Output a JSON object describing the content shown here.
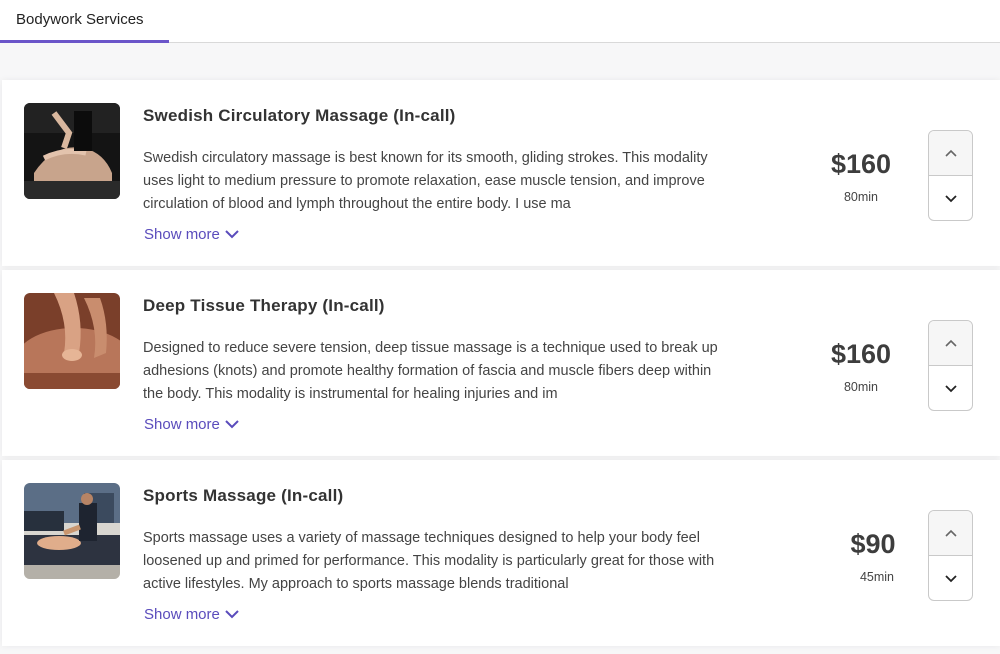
{
  "tabs": [
    {
      "label": "Bodywork Services",
      "active": true
    }
  ],
  "services": [
    {
      "title": "Swedish Circulatory Massage (In-call)",
      "description_lines": [
        "Swedish circulatory massage is best known for its smooth, gliding strokes. This modality",
        "uses light to medium pressure to promote relaxation, ease muscle tension, and improve",
        "circulation of blood and lymph throughout the entire body. I use ma"
      ],
      "show_more": "Show more",
      "price": "$160",
      "duration": "80min",
      "image": "swedish-massage-photo"
    },
    {
      "title": "Deep Tissue Therapy (In-call)",
      "description_lines": [
        "Designed to reduce severe tension, deep tissue massage is a technique used to break up",
        "adhesions (knots) and promote healthy formation of fascia and muscle fibers deep within",
        "the body. This modality is instrumental for healing injuries and im"
      ],
      "show_more": "Show more",
      "price": "$160",
      "duration": "80min",
      "image": "deep-tissue-photo"
    },
    {
      "title": "Sports Massage (In-call)",
      "description_lines": [
        "Sports massage uses a variety of massage techniques designed to help your body feel",
        "loosened up and primed for performance. This modality is particularly great for those with",
        "active lifestyles. My approach to sports massage blends traditional"
      ],
      "show_more": "Show more",
      "price": "$90",
      "duration": "45min",
      "image": "sports-massage-photo"
    }
  ],
  "icons": {
    "expand": "chevron-down-icon",
    "increment": "chevron-up-icon",
    "decrement": "chevron-down-icon"
  },
  "colors": {
    "accent": "#6b55c9",
    "link": "#5a4cbc"
  }
}
